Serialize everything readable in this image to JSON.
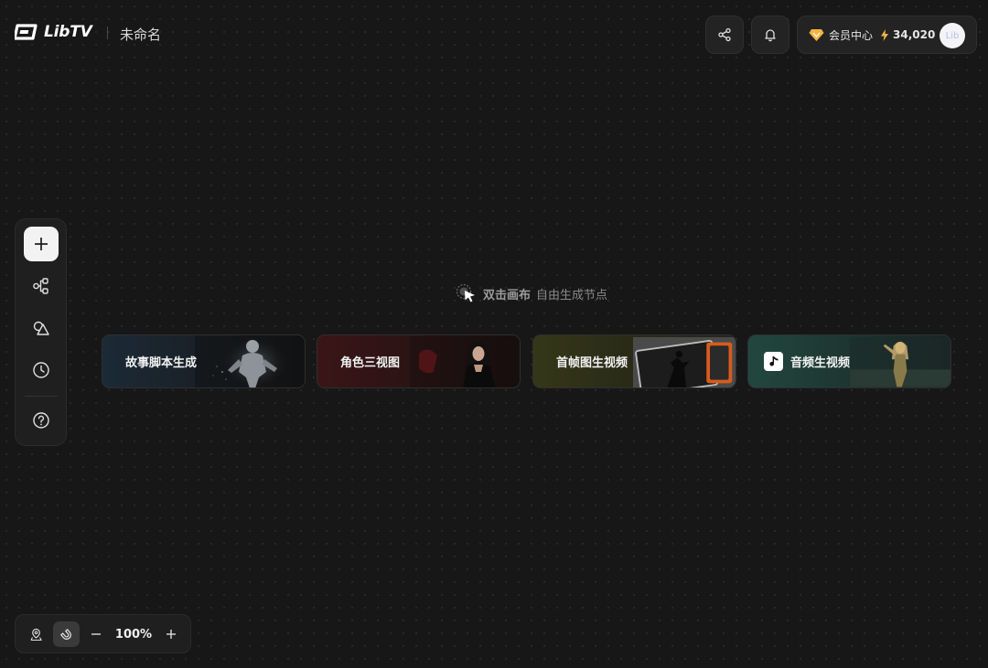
{
  "header": {
    "brand": "LibTV",
    "doc_title": "未命名",
    "member_label": "会员中心",
    "credits": "34,020",
    "avatar_text": "Lib"
  },
  "toolbar": {
    "items": [
      "add",
      "workflow",
      "shapes",
      "history",
      "help"
    ]
  },
  "hint": {
    "strong": "双击画布",
    "weak": "自由生成节点"
  },
  "templates": [
    {
      "label": "故事脚本生成"
    },
    {
      "label": "角色三视图"
    },
    {
      "label": "首帧图生视频"
    },
    {
      "label": "音频生视频"
    }
  ],
  "zoom": {
    "value": "100%"
  },
  "colors": {
    "background": "#171717",
    "panel": "#1f1f1f",
    "accent_gold": "#f5b342"
  }
}
